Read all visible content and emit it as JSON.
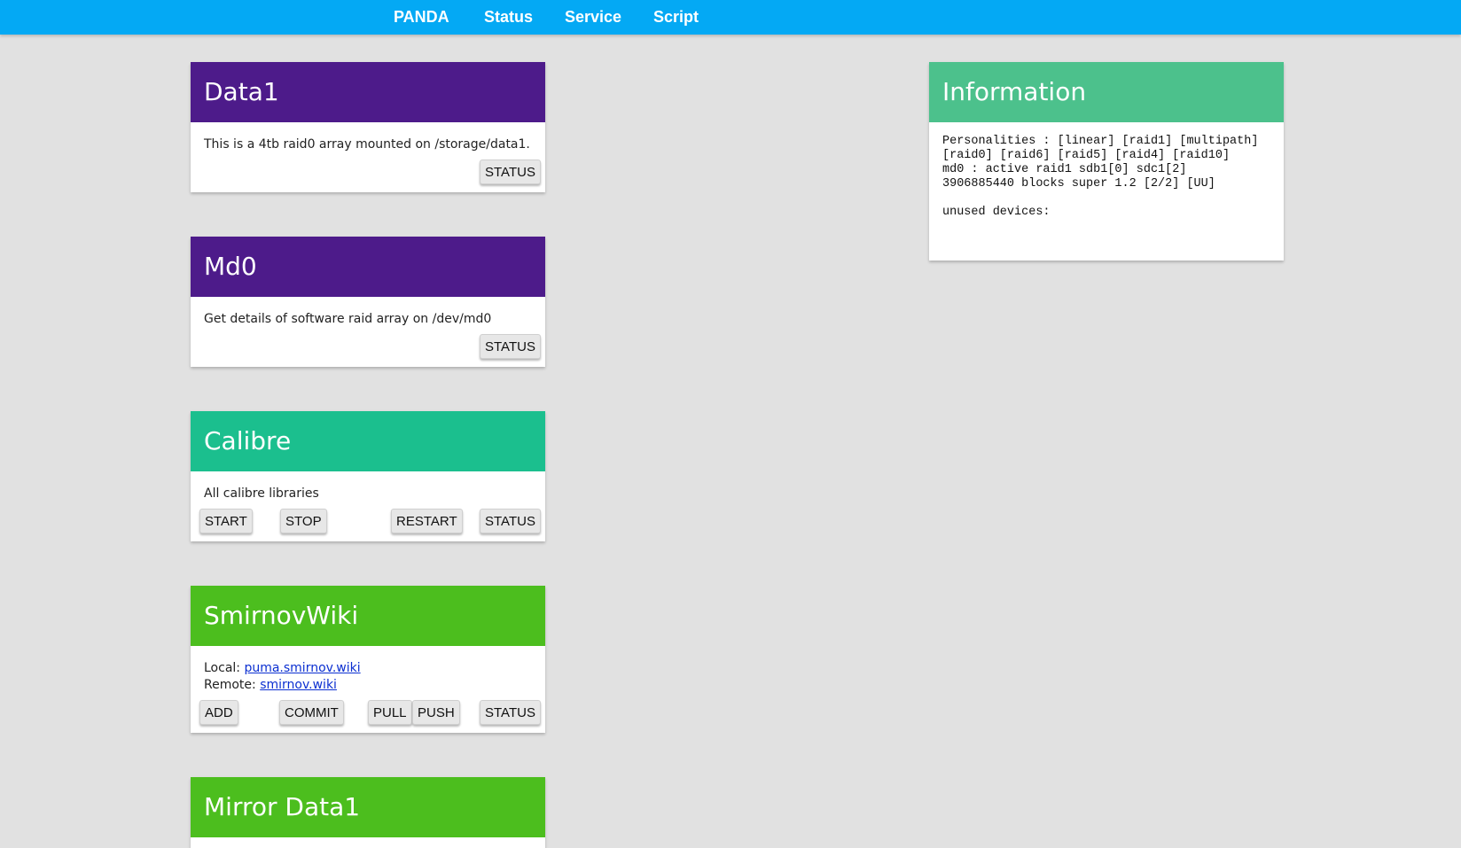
{
  "nav": {
    "brand": "PANDA",
    "items": [
      "Status",
      "Service",
      "Script"
    ]
  },
  "colors": {
    "nav": "#04a9f4",
    "purple": "#4d1b8a",
    "teal": "#1bbf8e",
    "green": "#4cbe1e",
    "info": "#4cc18c"
  },
  "cards": {
    "data1": {
      "title": "Data1",
      "description": "This is a 4tb raid0 array mounted on /storage/data1.",
      "buttons": [
        "STATUS"
      ]
    },
    "md0": {
      "title": "Md0",
      "description": "Get details of software raid array on /dev/md0",
      "buttons": [
        "STATUS"
      ]
    },
    "calibre": {
      "title": "Calibre",
      "description": "All calibre libraries",
      "buttons": [
        "START",
        "STOP",
        "RESTART",
        "STATUS"
      ]
    },
    "smirnovwiki": {
      "title": "SmirnovWiki",
      "local_label": "Local: ",
      "local_link": "puma.smirnov.wiki",
      "remote_label": "Remote: ",
      "remote_link": "smirnov.wiki",
      "buttons": [
        "ADD",
        "COMMIT",
        "PULL",
        "PUSH",
        "STATUS"
      ]
    },
    "mirror_data1": {
      "title": "Mirror Data1"
    }
  },
  "information": {
    "title": "Information",
    "text": "Personalities : [linear] [raid1] [multipath]\n[raid0] [raid6] [raid5] [raid4] [raid10]\nmd0 : active raid1 sdb1[0] sdc1[2]\n3906885440 blocks super 1.2 [2/2] [UU]\n\nunused devices:"
  }
}
